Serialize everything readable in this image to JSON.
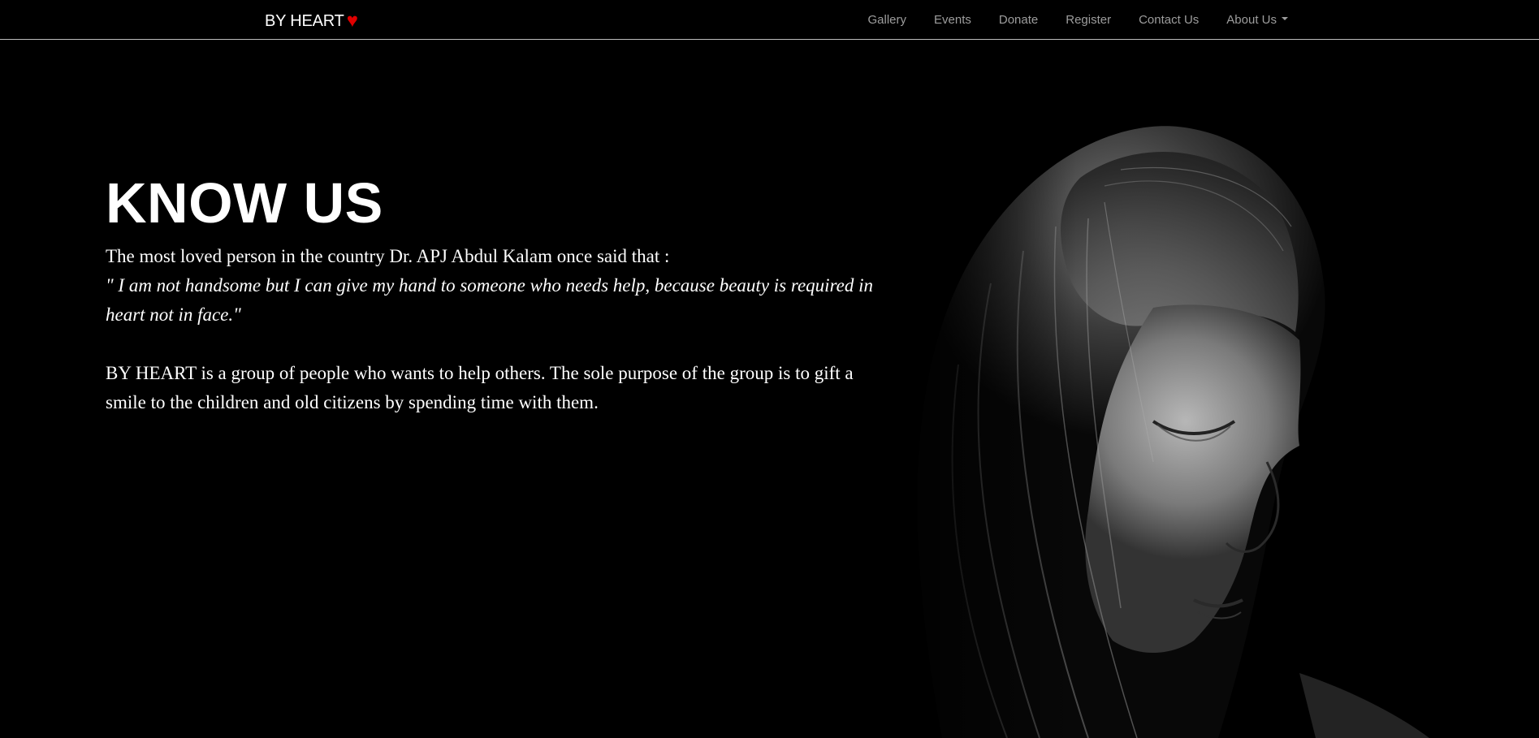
{
  "navbar": {
    "brand": "BY HEART",
    "brand_icon": "heart-icon",
    "brand_icon_glyph": "♥",
    "brand_icon_color": "#e00000",
    "links": [
      {
        "label": "Gallery"
      },
      {
        "label": "Events"
      },
      {
        "label": "Donate"
      },
      {
        "label": "Register"
      },
      {
        "label": "Contact Us"
      },
      {
        "label": "About Us",
        "dropdown": true
      }
    ]
  },
  "hero": {
    "title": "KNOW US",
    "intro": "The most loved person in the country Dr. APJ Abdul Kalam once said that :",
    "quote": "\" I am not handsome but I can give my hand to someone who needs help, because beauty is required in heart not in face.\"",
    "description": "BY HEART is a group of people who wants to help others. The sole purpose of the group is to gift a smile to the children and old citizens by spending time with them."
  },
  "colors": {
    "background": "#000000",
    "nav_text": "#9d9d9d",
    "heart": "#e00000"
  }
}
